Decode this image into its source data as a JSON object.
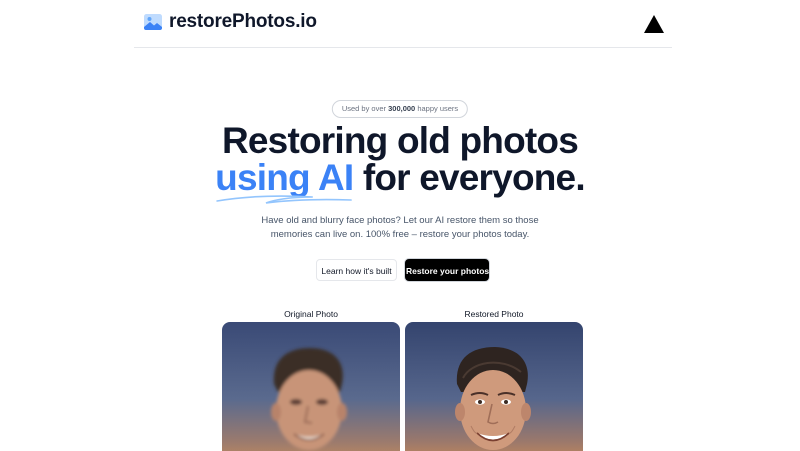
{
  "header": {
    "brand_name": "restorePhotos.io",
    "brand_icon": "photo-icon",
    "vercel_icon": "triangle-logo-icon"
  },
  "hero": {
    "pill_prefix": "Used by over",
    "pill_count": "300,000",
    "pill_suffix": "happy users",
    "headline_line1": "Restoring old photos",
    "headline_accent": "using AI",
    "headline_rest": "for everyone.",
    "subtitle_line1": "Have old and blurry face photos? Let our AI restore them so those",
    "subtitle_line2": "memories can live on. 100% free – restore your photos today."
  },
  "buttons": {
    "secondary_label": "Learn how it's built",
    "primary_label": "Restore your photos"
  },
  "comparison": {
    "original_label": "Original Photo",
    "restored_label": "Restored Photo"
  },
  "colors": {
    "accent": "#3b82f6",
    "text": "#0f172a",
    "muted": "#475569"
  }
}
